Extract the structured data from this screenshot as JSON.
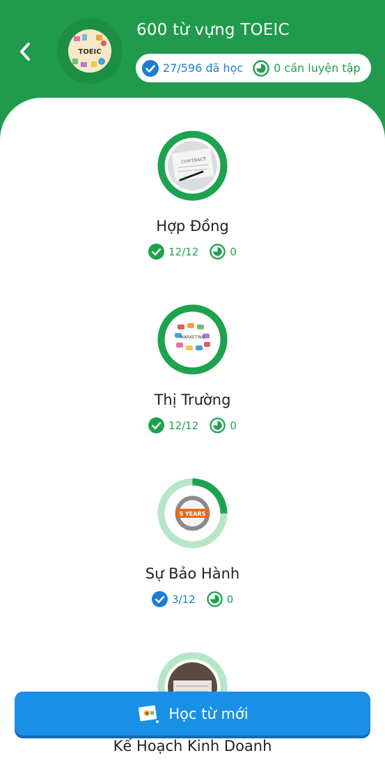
{
  "header": {
    "back_icon": "chevron-left-icon",
    "deck_title": "600 từ vựng TOEIC",
    "deck_avatar_text": "TOEIC",
    "learned": "27/596 đã học",
    "to_practice": "0 cần luyện tập"
  },
  "topics": [
    {
      "name": "Hợp Đồng",
      "learned": "12/12",
      "practice": "0",
      "progress": 1.0,
      "status": "complete",
      "image_text": "CONTRACT"
    },
    {
      "name": "Thị Trường",
      "learned": "12/12",
      "practice": "0",
      "progress": 1.0,
      "status": "complete",
      "image_text": "MARKETING"
    },
    {
      "name": "Sự Bảo Hành",
      "learned": "3/12",
      "practice": "0",
      "progress": 0.25,
      "status": "in-progress",
      "image_text": "5 YEARS"
    },
    {
      "name": "Kế Hoạch Kinh Doanh",
      "learned": "",
      "practice": "",
      "progress": 0.0,
      "status": "in-progress"
    }
  ],
  "cta": {
    "label": "Học từ mới",
    "icon": "flashcard-icon"
  },
  "colors": {
    "header_green": "#1f9a4b",
    "accent_green": "#1da24e",
    "accent_blue": "#1a7fd4",
    "ring_track": "#b6e6c6",
    "cta_blue": "#1a8fe6"
  }
}
